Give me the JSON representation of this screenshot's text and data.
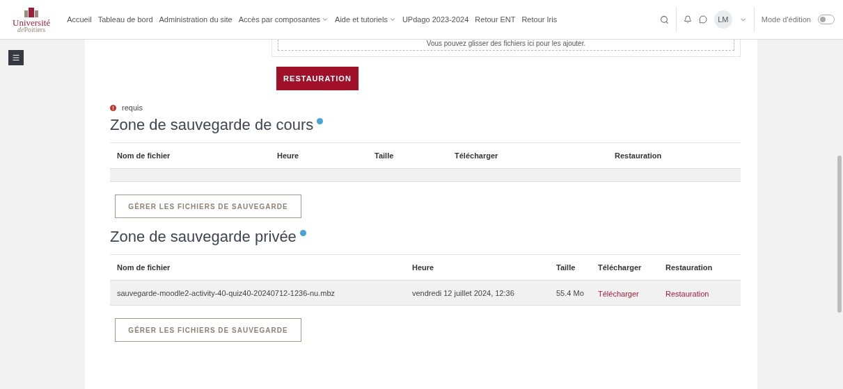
{
  "logo": {
    "line_1": "Université",
    "line_2": "de",
    "line_3": "Poitiers"
  },
  "nav": [
    {
      "label": "Accueil",
      "dropdown": false
    },
    {
      "label": "Tableau de bord",
      "dropdown": false
    },
    {
      "label": "Administration du site",
      "dropdown": false
    },
    {
      "label": "Accès par composantes",
      "dropdown": true
    },
    {
      "label": "Aide et tutoriels",
      "dropdown": true
    },
    {
      "label": "UPdago 2023-2024",
      "dropdown": false
    },
    {
      "label": "Retour ENT",
      "dropdown": false
    },
    {
      "label": "Retour Iris",
      "dropdown": false
    }
  ],
  "user": {
    "initials": "LM"
  },
  "edit_mode": {
    "label": "Mode d'édition",
    "on": false
  },
  "dropzone": {
    "hint": "Vous pouvez glisser des fichiers ici pour les ajouter."
  },
  "restore_button": "RESTAURATION",
  "required_note": "requis",
  "sections": [
    {
      "kind": "course",
      "title": "Zone de sauvegarde de cours",
      "columns": [
        "Nom de fichier",
        "Heure",
        "Taille",
        "Télécharger",
        "Restauration"
      ],
      "button": "GÉRER LES FICHIERS DE SAUVEGARDE"
    },
    {
      "kind": "private",
      "title": "Zone de sauvegarde privée",
      "columns": [
        "Nom de fichier",
        "Heure",
        "Taille",
        "Télécharger",
        "Restauration"
      ],
      "rows": [
        [
          "sauvegarde-moodle2-activity-40-quiz40-20240712-1236-nu.mbz",
          "vendredi 12 juillet 2024, 12:36",
          "55.4 Mo",
          "Télécharger",
          "Restauration"
        ]
      ],
      "button": "GÉRER LES FICHIERS DE SAUVEGARDE"
    }
  ]
}
